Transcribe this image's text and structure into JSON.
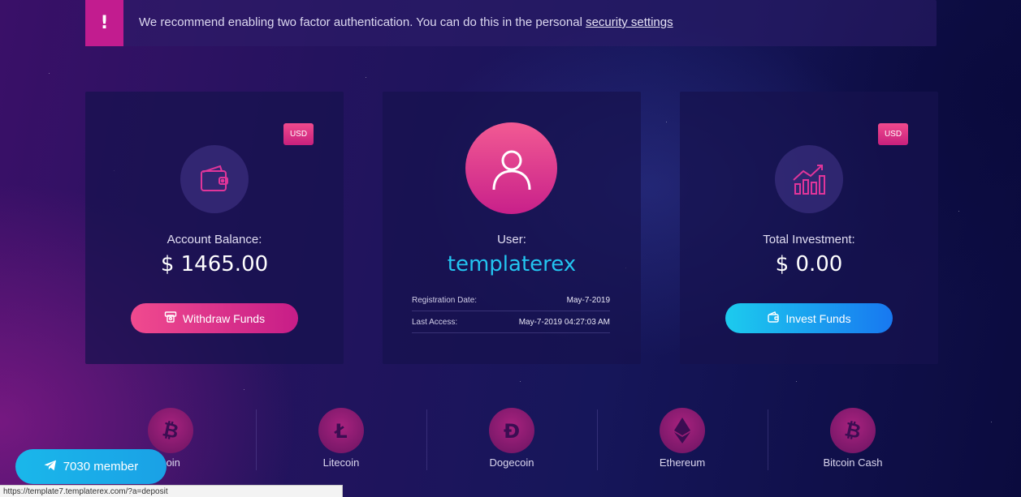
{
  "alert": {
    "icon_symbol": "!",
    "message": "We recommend enabling two factor authentication. You can do this in the personal ",
    "link_text": "security settings"
  },
  "balance_card": {
    "currency": "USD",
    "label": "Account Balance:",
    "amount": "$ 1465.00",
    "button": "Withdraw Funds",
    "icon": "wallet-icon"
  },
  "user_card": {
    "label": "User:",
    "username": "templaterex",
    "rows": [
      {
        "label": "Registration Date:",
        "value": "May-7-2019"
      },
      {
        "label": "Last Access:",
        "value": "May-7-2019 04:27:03 AM"
      }
    ],
    "icon": "user-icon"
  },
  "investment_card": {
    "currency": "USD",
    "label": "Total Investment:",
    "amount": "$ 0.00",
    "button": "Invest Funds",
    "icon": "growth-chart-icon"
  },
  "coins": [
    {
      "name": "coin",
      "icon": "bitcoin-icon"
    },
    {
      "name": "Litecoin",
      "icon": "litecoin-icon"
    },
    {
      "name": "Dogecoin",
      "icon": "dogecoin-icon"
    },
    {
      "name": "Ethereum",
      "icon": "ethereum-icon"
    },
    {
      "name": "Bitcoin Cash",
      "icon": "bitcoin-cash-icon"
    }
  ],
  "telegram": {
    "label": "7030 member",
    "icon": "telegram-icon"
  },
  "status_bar": {
    "url": "https://template7.templaterex.com/?a=deposit"
  },
  "colors": {
    "accent_pink": "#c21c8f",
    "accent_blue": "#1ccbee",
    "username": "#23c4f0"
  }
}
